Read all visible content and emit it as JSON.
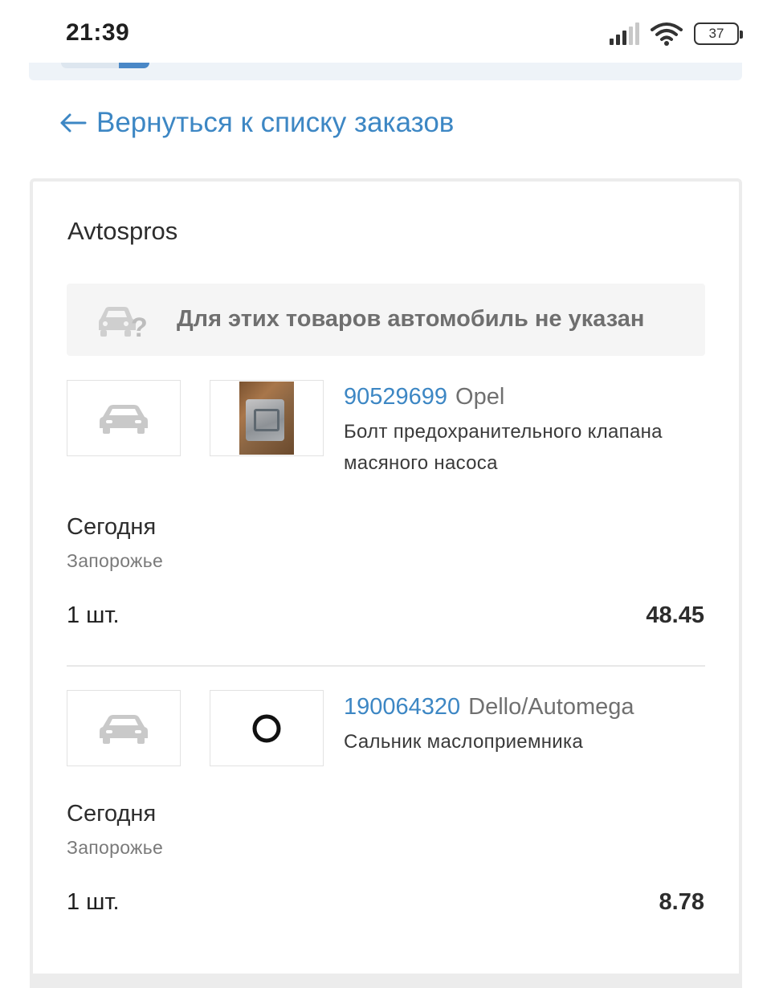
{
  "status_bar": {
    "time": "21:39",
    "battery": "37"
  },
  "nav": {
    "back_link": "Вернуться к списку заказов"
  },
  "order": {
    "supplier": "Avtospros",
    "notice": "Для этих товаров автомобиль не указан",
    "items": [
      {
        "part_number": "90529699",
        "brand": "Opel",
        "description": "Болт предохранительного клапана масяного насоса",
        "delivery": "Сегодня",
        "city": "Запорожье",
        "quantity": "1 шт.",
        "price": "48.45",
        "image": "photo-thumbnail"
      },
      {
        "part_number": "190064320",
        "brand": "Dello/Automega",
        "description": "Сальник маслоприемника",
        "delivery": "Сегодня",
        "city": "Запорожье",
        "quantity": "1 шт.",
        "price": "8.78",
        "image": "o-ring-thumbnail"
      }
    ]
  },
  "colors": {
    "accent": "#3d87c4",
    "notice_bg": "#f5f5f5",
    "muted_text": "#7a7a7a"
  }
}
